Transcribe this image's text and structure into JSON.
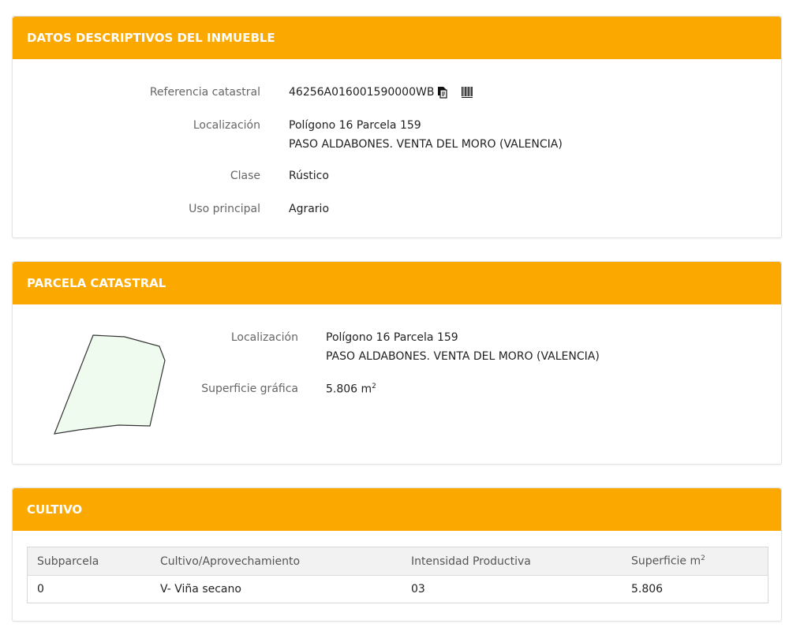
{
  "datos": {
    "title": "DATOS DESCRIPTIVOS DEL INMUEBLE",
    "referencia_label": "Referencia catastral",
    "referencia_value": "46256A016001590000WB",
    "localizacion_label": "Localización",
    "localizacion_line1": "Polígono 16 Parcela 159",
    "localizacion_line2": "PASO ALDABONES. VENTA DEL MORO (VALENCIA)",
    "clase_label": "Clase",
    "clase_value": "Rústico",
    "uso_label": "Uso principal",
    "uso_value": "Agrario",
    "icons": [
      "copy-icon",
      "barcode-icon"
    ]
  },
  "parcela": {
    "title": "PARCELA CATASTRAL",
    "localizacion_label": "Localización",
    "localizacion_line1": "Polígono 16 Parcela 159",
    "localizacion_line2": "PASO ALDABONES. VENTA DEL MORO (VALENCIA)",
    "superficie_label": "Superficie gráfica",
    "superficie_value": "5.806 m",
    "superficie_sup": "2",
    "shape_fill": "#eefbee",
    "shape_stroke": "#333333"
  },
  "cultivo": {
    "title": "CULTIVO",
    "headers": [
      "Subparcela",
      "Cultivo/Aprovechamiento",
      "Intensidad Productiva",
      "Superficie m"
    ],
    "header_sup": "2",
    "rows": [
      [
        "0",
        "V- Viña secano",
        "03",
        "5.806"
      ]
    ]
  },
  "colors": {
    "header_bg": "#fba900",
    "header_text": "#ffffff"
  }
}
